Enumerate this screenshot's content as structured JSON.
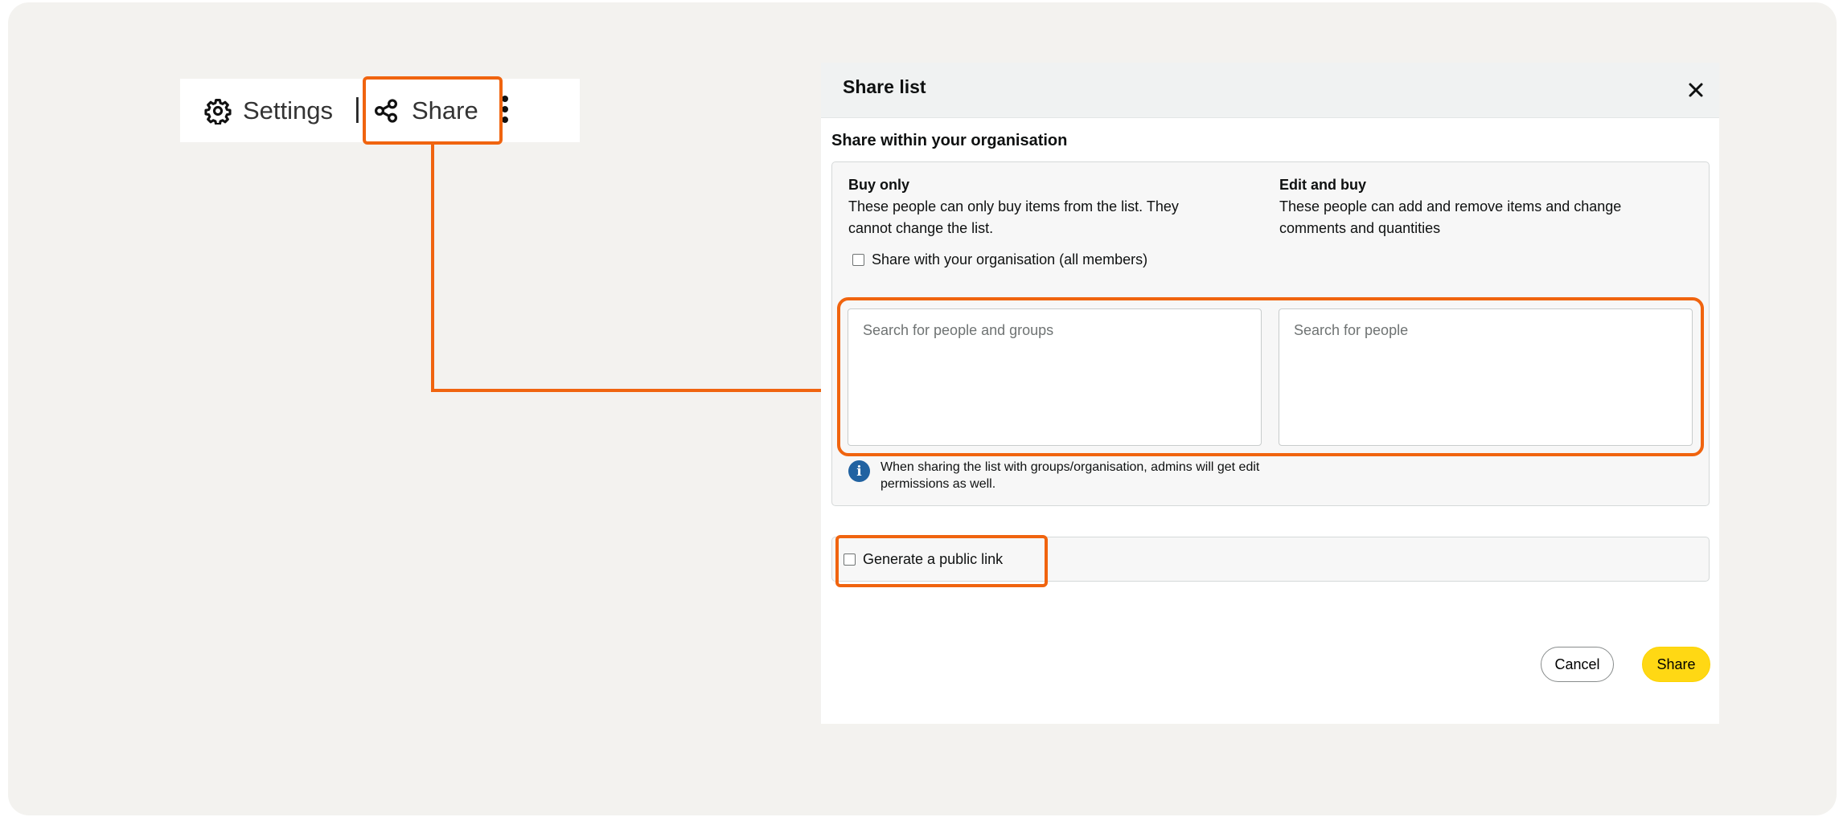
{
  "colors": {
    "highlight": "#f0640f",
    "page_background": "#f3f2ef",
    "primary_button": "#ffd814",
    "info_icon": "#2162a1"
  },
  "toolbar": {
    "settings_label": "Settings",
    "settings_icon": "gear-icon",
    "separator": "|",
    "share_label": "Share",
    "share_icon": "share-icon",
    "more_icon": "more-vertical-icon"
  },
  "dialog": {
    "title": "Share list",
    "close_icon": "close-icon",
    "org_section": {
      "title": "Share within your organisation",
      "buy_only": {
        "title": "Buy only",
        "description": "These people can only buy items from the list. They cannot change the list."
      },
      "edit_and_buy": {
        "title": "Edit and buy",
        "description": "These people can add and remove items and change comments and quantities"
      },
      "share_with_org_label": "Share with your organisation (all members)",
      "share_with_org_checked": false,
      "buy_only_search": {
        "placeholder": "Search for people and groups",
        "value": ""
      },
      "edit_search": {
        "placeholder": "Search for people",
        "value": ""
      },
      "info_icon": "info-icon",
      "info_text": "When sharing the list with groups/organisation, admins will get edit permissions as well."
    },
    "public_link": {
      "label": "Generate a public link",
      "checked": false
    },
    "buttons": {
      "cancel": "Cancel",
      "share": "Share"
    }
  }
}
